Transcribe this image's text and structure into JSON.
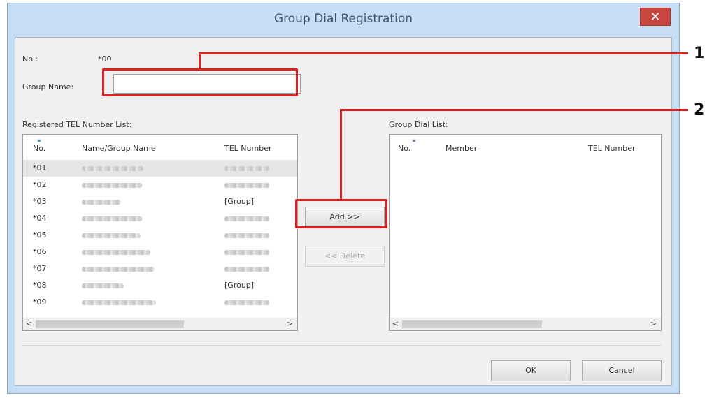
{
  "window": {
    "title": "Group Dial Registration",
    "close_glyph": "✕"
  },
  "form": {
    "no_label": "No.:",
    "no_value": "*00",
    "group_name_label": "Group Name:",
    "group_name_value": ""
  },
  "registered": {
    "label": "Registered TEL Number List:",
    "columns": [
      "No.",
      "Name/Group Name",
      "TEL Number"
    ],
    "rows": [
      {
        "no": "*01",
        "tel": ""
      },
      {
        "no": "*02",
        "tel": ""
      },
      {
        "no": "*03",
        "tel": "[Group]"
      },
      {
        "no": "*04",
        "tel": ""
      },
      {
        "no": "*05",
        "tel": ""
      },
      {
        "no": "*06",
        "tel": ""
      },
      {
        "no": "*07",
        "tel": ""
      },
      {
        "no": "*08",
        "tel": "[Group]"
      },
      {
        "no": "*09",
        "tel": ""
      }
    ]
  },
  "group_dial": {
    "label": "Group Dial List:",
    "columns": [
      "No.",
      "Member",
      "TEL Number"
    ]
  },
  "buttons": {
    "add": "Add >>",
    "delete": "<< Delete",
    "ok": "OK",
    "cancel": "Cancel"
  },
  "scroll": {
    "left_glyph": "<",
    "right_glyph": ">"
  },
  "callouts": {
    "one": "1",
    "two": "2"
  },
  "colors": {
    "callout": "#e0201f",
    "titlebar": "#c8def4",
    "close": "#c7463f"
  },
  "icons": [
    "close-icon",
    "sort-ascending-icon",
    "scroll-left-icon",
    "scroll-right-icon"
  ]
}
